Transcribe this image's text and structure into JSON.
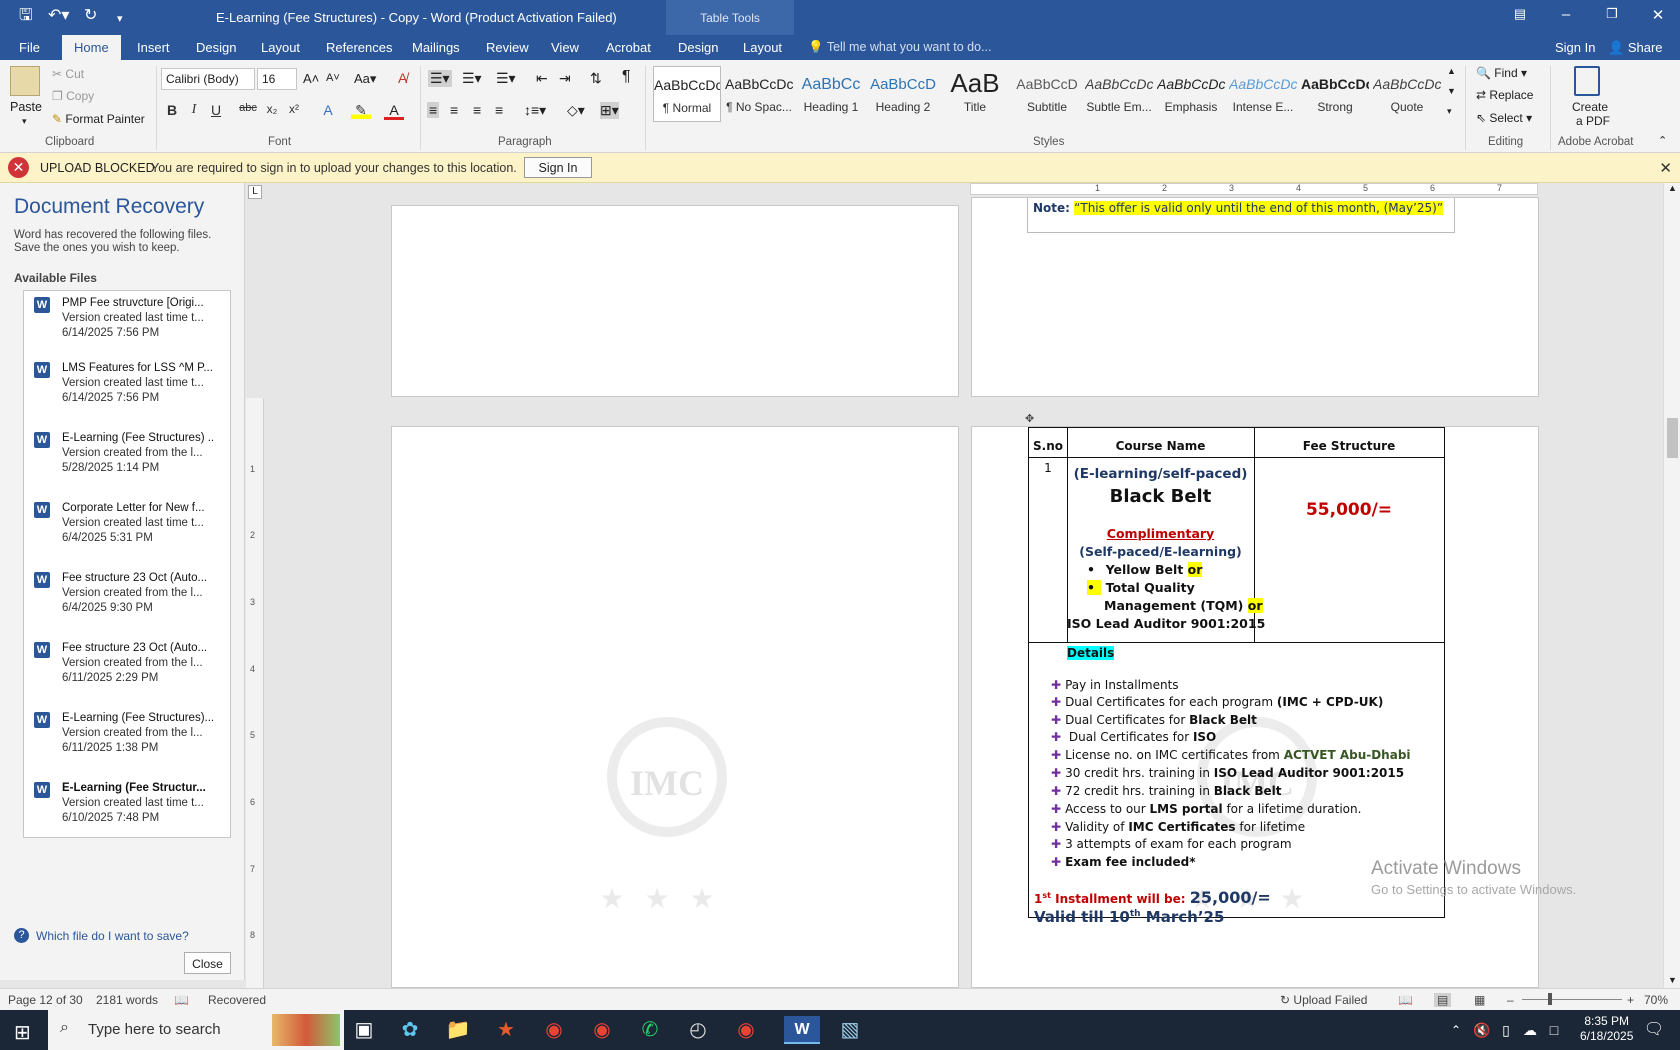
{
  "titlebar": {
    "doc_title": "E-Learning (Fee Structures) - Copy - Word (Product Activation Failed)",
    "table_tools": "Table Tools",
    "save_icon": "save-icon",
    "undo_icon": "undo-icon",
    "redo_icon": "redo-icon",
    "customize_icon": "customize-icon"
  },
  "tabs": [
    "File",
    "Home",
    "Insert",
    "Design",
    "Layout",
    "References",
    "Mailings",
    "Review",
    "View",
    "Acrobat",
    "Design",
    "Layout"
  ],
  "tellme": "Tell me what you want to do...",
  "signin": "Sign In",
  "share": "Share",
  "ribbon": {
    "clipboard": {
      "paste": "Paste",
      "cut": "Cut",
      "copy": "Copy",
      "format_painter": "Format Painter",
      "label": "Clipboard"
    },
    "font": {
      "name": "Calibri (Body)",
      "size": "16",
      "label": "Font"
    },
    "paragraph": {
      "label": "Paragraph"
    },
    "styles": {
      "label": "Styles",
      "items": [
        {
          "preview": "AaBbCcDc",
          "name": "¶ Normal"
        },
        {
          "preview": "AaBbCcDc",
          "name": "¶ No Spac..."
        },
        {
          "preview": "AaBbCc",
          "name": "Heading 1"
        },
        {
          "preview": "AaBbCcD",
          "name": "Heading 2"
        },
        {
          "preview": "AaB",
          "name": "Title"
        },
        {
          "preview": "AaBbCcD",
          "name": "Subtitle"
        },
        {
          "preview": "AaBbCcDc",
          "name": "Subtle Em..."
        },
        {
          "preview": "AaBbCcDc",
          "name": "Emphasis"
        },
        {
          "preview": "AaBbCcDc",
          "name": "Intense E..."
        },
        {
          "preview": "AaBbCcDc",
          "name": "Strong"
        },
        {
          "preview": "AaBbCcDc",
          "name": "Quote"
        }
      ]
    },
    "editing": {
      "find": "Find",
      "replace": "Replace",
      "select": "Select",
      "label": "Editing"
    },
    "acrobat": {
      "create_pdf_1": "Create",
      "create_pdf_2": "a PDF",
      "label": "Adobe Acrobat"
    }
  },
  "msgbar": {
    "title": "UPLOAD BLOCKED",
    "text": "You are required to sign in to upload your changes to this location.",
    "button": "Sign In"
  },
  "recovery": {
    "title": "Document Recovery",
    "desc_1": "Word has recovered the following files.",
    "desc_2": "Save the ones you wish to keep.",
    "available": "Available Files",
    "files": [
      {
        "name": "PMP Fee struvcture  [Origi...",
        "desc": "Version created last time t...",
        "time": "6/14/2025 7:56 PM"
      },
      {
        "name": "LMS Features for LSS ^M P...",
        "desc": "Version created last time t...",
        "time": "6/14/2025 7:56 PM"
      },
      {
        "name": "E-Learning (Fee Structures) ..",
        "desc": "Version created from the l...",
        "time": "5/28/2025 1:14 PM"
      },
      {
        "name": "Corporate Letter for New f...",
        "desc": "Version created last time t...",
        "time": "6/4/2025 5:31 PM"
      },
      {
        "name": "Fee structure 23 Oct (Auto...",
        "desc": "Version created from the l...",
        "time": "6/4/2025 9:30 PM"
      },
      {
        "name": "Fee structure 23 Oct (Auto...",
        "desc": "Version created from the l...",
        "time": "6/11/2025 2:29 PM"
      },
      {
        "name": "E-Learning (Fee Structures)...",
        "desc": "Version created from the l...",
        "time": "6/11/2025 1:38 PM"
      },
      {
        "name": "E-Learning (Fee Structur...",
        "desc": "Version created last time t...",
        "time": "6/10/2025 7:48 PM"
      }
    ],
    "help": "Which file do I want to save?",
    "close": "Close"
  },
  "document": {
    "note_label": "Note:",
    "note_text": "“This offer is valid only until the end of this month, (May’25)”",
    "table": {
      "headers": [
        "S.no",
        "Course Name",
        "Fee Structure"
      ],
      "sno": "1",
      "mode": "(E-learning/self-paced)",
      "course": "Black Belt",
      "complimentary": "Complimentary",
      "comp_mode": "(Self-paced/E-learning)",
      "bullet1": "Yellow Belt",
      "bullet2a": "Total Quality",
      "bullet2b": "Management (TQM)",
      "or": "or",
      "iso": "ISO Lead Auditor 9001:2015",
      "fee": "55,000/=",
      "details": "Details",
      "installment_label": "Installment will be:",
      "installment_prefix": "1",
      "installment_sup": "st",
      "installment_value": "25,000/=",
      "valid_prefix": "Valid till 10",
      "valid_sup": "th",
      "valid_suffix": " March’25"
    },
    "details": [
      {
        "a": "Pay in Installments"
      },
      {
        "a": "Dual Certificates for each program ",
        "b": "(IMC + CPD-UK)"
      },
      {
        "a": "Dual Certificates for ",
        "b": "Black Belt"
      },
      {
        "a": " Dual Certificates for ",
        "b": "ISO"
      },
      {
        "a": "License no. on IMC certificates from ",
        "g": "ACTVET Abu-Dhabi"
      },
      {
        "a": "30 credit hrs. training in ",
        "b": "ISO Lead Auditor 9001:2015"
      },
      {
        "a": "72 credit hrs. training in ",
        "b": "Black Belt"
      },
      {
        "a": "Access to our ",
        "b": "LMS portal",
        "c": " for a lifetime duration."
      },
      {
        "a": "Validity of ",
        "b": "IMC Certificates",
        "c": " for lifetime"
      },
      {
        "a": "3 attempts of exam for each program"
      },
      {
        "b": "Exam fee included*"
      }
    ],
    "watermark": "IMC"
  },
  "activate": {
    "line1": "Activate Windows",
    "line2": "Go to Settings to activate Windows."
  },
  "status": {
    "page": "Page 12 of 30",
    "words": "2181 words",
    "recovered": "Recovered",
    "upload": "Upload Failed",
    "zoom": "70%"
  },
  "taskbar": {
    "search_placeholder": "Type here to search",
    "time": "8:35 PM",
    "date": "6/18/2025"
  },
  "colors": {
    "brand": "#2b579a",
    "msgbar": "#fdf3c8",
    "error": "#d13438",
    "fee_red": "#c00000",
    "highlight": "#ffff00",
    "details_hl": "#00ffff"
  }
}
